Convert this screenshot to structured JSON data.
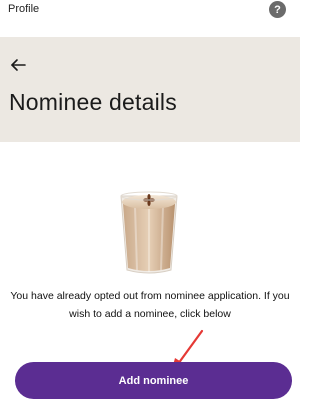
{
  "topbar": {
    "title": "Profile",
    "help_icon": "question-mark-icon",
    "help_symbol": "?"
  },
  "header": {
    "back_icon": "arrow-left-icon",
    "title": "Nominee details"
  },
  "main": {
    "illustration": "chai-glass-illustration",
    "message": "You have already opted out from nominee application. If you wish to add a nominee, click below",
    "annotation_icon": "red-arrow-annotation"
  },
  "footer": {
    "add_button_label": "Add nominee"
  },
  "colors": {
    "header_bg": "#ece8e2",
    "primary_button": "#5b2d92",
    "annotation": "#e53935"
  }
}
